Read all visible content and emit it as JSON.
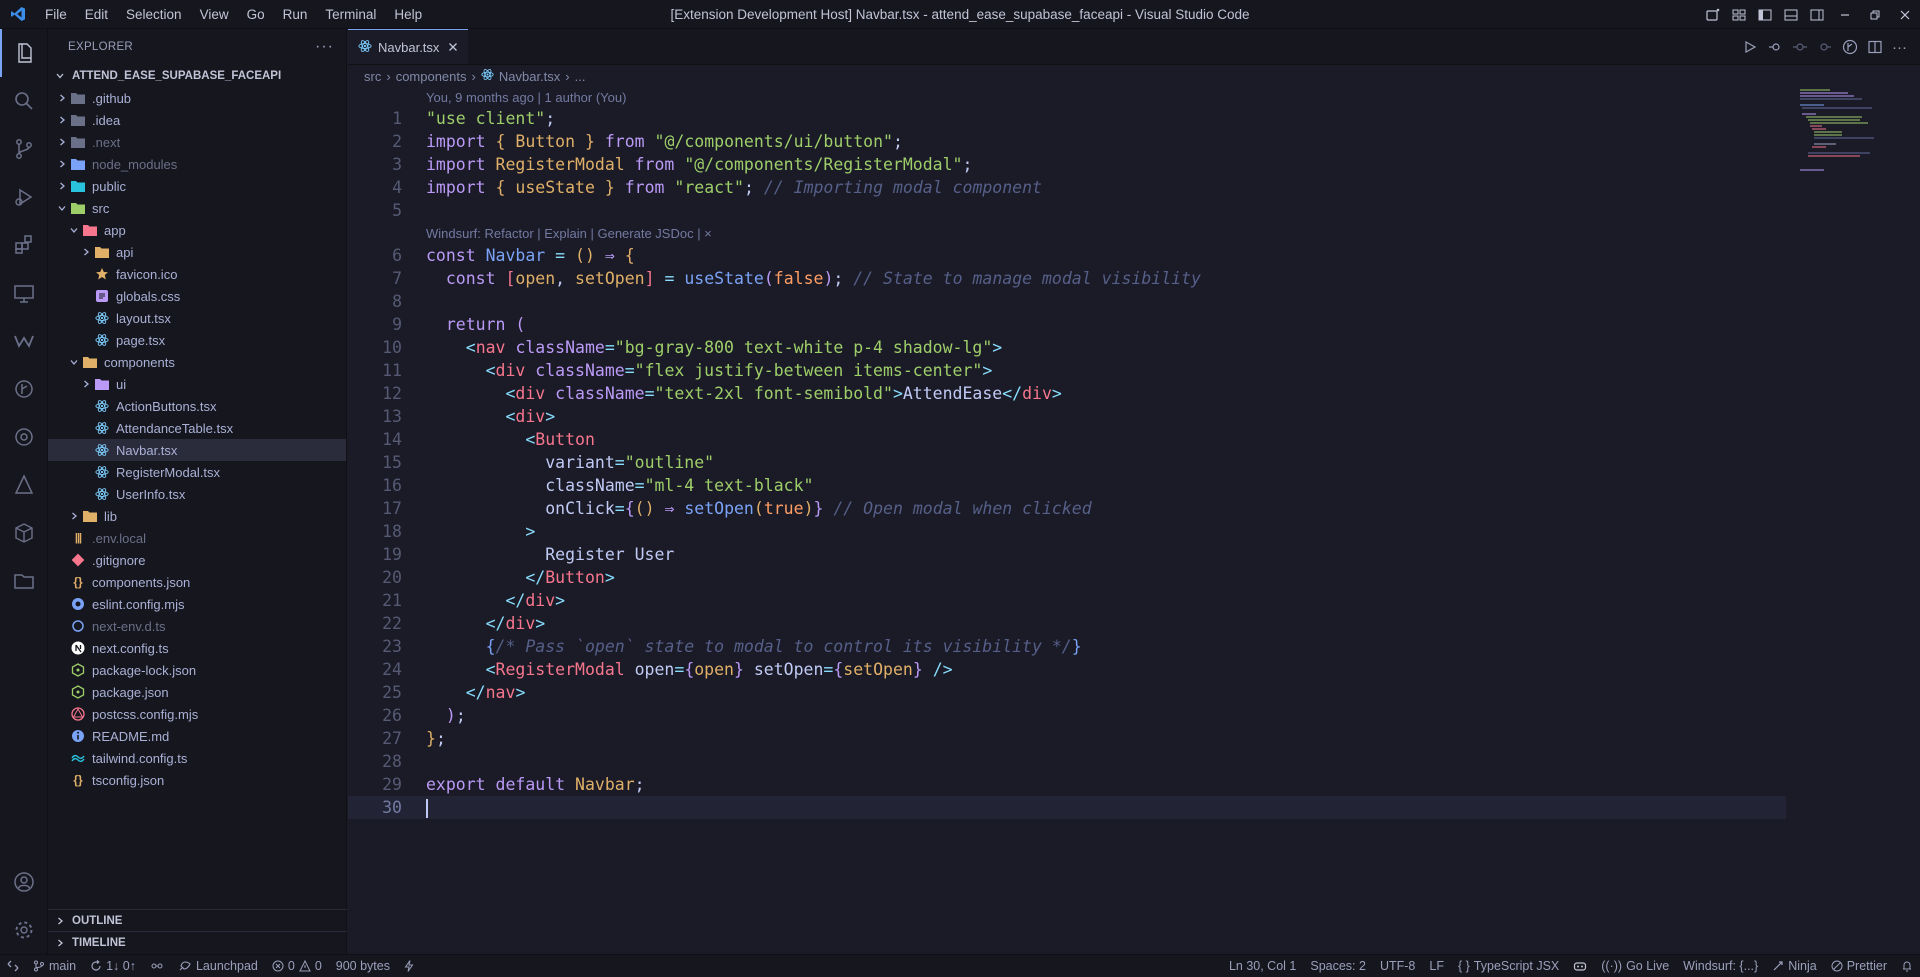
{
  "window": {
    "title": "[Extension Development Host] Navbar.tsx - attend_ease_supabase_faceapi - Visual Studio Code",
    "menu": [
      "File",
      "Edit",
      "Selection",
      "View",
      "Go",
      "Run",
      "Terminal",
      "Help"
    ]
  },
  "sidebar": {
    "header": "EXPLORER",
    "project": "ATTEND_EASE_SUPABASE_FACEAPI",
    "items": [
      {
        "label": ".github",
        "indent": 1,
        "type": "folder",
        "chevron": "right",
        "color": "#6b7089"
      },
      {
        "label": ".idea",
        "indent": 1,
        "type": "folder",
        "chevron": "right",
        "color": "#6b7089"
      },
      {
        "label": ".next",
        "indent": 1,
        "type": "folder",
        "chevron": "right",
        "color": "#6b7089",
        "dim": true
      },
      {
        "label": "node_modules",
        "indent": 1,
        "type": "folder",
        "chevron": "right",
        "color": "#7aa2f7",
        "dim": true
      },
      {
        "label": "public",
        "indent": 1,
        "type": "folder",
        "chevron": "right",
        "color": "#2ac3de"
      },
      {
        "label": "src",
        "indent": 1,
        "type": "folder",
        "chevron": "down",
        "color": "#9ece6a"
      },
      {
        "label": "app",
        "indent": 2,
        "type": "folder",
        "chevron": "down",
        "color": "#f7768e"
      },
      {
        "label": "api",
        "indent": 3,
        "type": "folder",
        "chevron": "right",
        "color": "#e0af68"
      },
      {
        "label": "favicon.ico",
        "indent": 3,
        "type": "star",
        "color": "#e0af68"
      },
      {
        "label": "globals.css",
        "indent": 3,
        "type": "css",
        "color": "#bb9af7"
      },
      {
        "label": "layout.tsx",
        "indent": 3,
        "type": "react",
        "color": "#7dcfff"
      },
      {
        "label": "page.tsx",
        "indent": 3,
        "type": "react",
        "color": "#7dcfff"
      },
      {
        "label": "components",
        "indent": 2,
        "type": "folder",
        "chevron": "down",
        "color": "#e0af68"
      },
      {
        "label": "ui",
        "indent": 3,
        "type": "folder",
        "chevron": "right",
        "color": "#bb9af7"
      },
      {
        "label": "ActionButtons.tsx",
        "indent": 3,
        "type": "react",
        "color": "#7dcfff"
      },
      {
        "label": "AttendanceTable.tsx",
        "indent": 3,
        "type": "react",
        "color": "#7dcfff"
      },
      {
        "label": "Navbar.tsx",
        "indent": 3,
        "type": "react",
        "color": "#7dcfff",
        "selected": true
      },
      {
        "label": "RegisterModal.tsx",
        "indent": 3,
        "type": "react",
        "color": "#7dcfff"
      },
      {
        "label": "UserInfo.tsx",
        "indent": 3,
        "type": "react",
        "color": "#7dcfff"
      },
      {
        "label": "lib",
        "indent": 2,
        "type": "folder",
        "chevron": "right",
        "color": "#e0af68"
      },
      {
        "label": ".env.local",
        "indent": 1,
        "type": "env",
        "color": "#e0af68",
        "dim": true
      },
      {
        "label": ".gitignore",
        "indent": 1,
        "type": "git",
        "color": "#f7768e"
      },
      {
        "label": "components.json",
        "indent": 1,
        "type": "json",
        "color": "#e0af68"
      },
      {
        "label": "eslint.config.mjs",
        "indent": 1,
        "type": "eslint",
        "color": "#7aa2f7"
      },
      {
        "label": "next-env.d.ts",
        "indent": 1,
        "type": "ts",
        "color": "#7aa2f7",
        "dim": true
      },
      {
        "label": "next.config.ts",
        "indent": 1,
        "type": "next",
        "color": "#ffffff"
      },
      {
        "label": "package-lock.json",
        "indent": 1,
        "type": "npm",
        "color": "#9ece6a"
      },
      {
        "label": "package.json",
        "indent": 1,
        "type": "npm",
        "color": "#9ece6a"
      },
      {
        "label": "postcss.config.mjs",
        "indent": 1,
        "type": "postcss",
        "color": "#f7768e"
      },
      {
        "label": "README.md",
        "indent": 1,
        "type": "info",
        "color": "#7aa2f7"
      },
      {
        "label": "tailwind.config.ts",
        "indent": 1,
        "type": "tailwind",
        "color": "#2ac3de"
      },
      {
        "label": "tsconfig.json",
        "indent": 1,
        "type": "json",
        "color": "#e0af68"
      }
    ],
    "outline": "OUTLINE",
    "timeline": "TIMELINE"
  },
  "editor": {
    "tab": "Navbar.tsx",
    "breadcrumb": [
      "src",
      "components",
      "Navbar.tsx",
      "..."
    ],
    "blame": "You, 9 months ago | 1 author (You)",
    "codelens": "Windsurf: Refactor | Explain | Generate JSDoc | ×",
    "lines": [
      {
        "n": "1",
        "html": "<span class='s'>\"use client\"</span><span class='p'>;</span>"
      },
      {
        "n": "2",
        "html": "<span class='k'>import</span> <span class='v'>{</span> <span class='v'>Button</span> <span class='v'>}</span> <span class='k'>from</span> <span class='s'>\"@/components/ui/button\"</span><span class='p'>;</span>"
      },
      {
        "n": "3",
        "html": "<span class='k'>import</span> <span class='v'>RegisterModal</span> <span class='k'>from</span> <span class='s'>\"@/components/RegisterModal\"</span><span class='p'>;</span>"
      },
      {
        "n": "4",
        "html": "<span class='k'>import</span> <span class='v'>{</span> <span class='v'>useState</span> <span class='v'>}</span> <span class='k'>from</span> <span class='s'>\"react\"</span><span class='p'>;</span> <span class='c'>// Importing modal component</span>"
      },
      {
        "n": "5",
        "html": ""
      },
      {
        "n": "6",
        "html": "<span class='k'>const</span> <span class='f'>Navbar</span> <span class='o'>=</span> <span class='v'>()</span> <span class='k'>⇒</span> <span class='v'>{</span>",
        "lens": true
      },
      {
        "n": "7",
        "html": "  <span class='k'>const</span> <span class='t'>[</span><span class='v'>open</span><span class='p'>,</span> <span class='v'>setOpen</span><span class='t'>]</span> <span class='o'>=</span> <span class='f'>useState</span><span class='k'>(</span><span class='b'>false</span><span class='k'>)</span><span class='p'>;</span> <span class='c'>// State to manage modal visibility</span>"
      },
      {
        "n": "8",
        "html": ""
      },
      {
        "n": "9",
        "html": "  <span class='k'>return</span> <span class='k'>(</span>"
      },
      {
        "n": "10",
        "html": "    <span class='o'>&lt;</span><span class='t'>nav</span> <span class='k'>className</span><span class='o'>=</span><span class='s'>\"bg-gray-800 text-white p-4 shadow-lg\"</span><span class='o'>&gt;</span>"
      },
      {
        "n": "11",
        "html": "      <span class='o'>&lt;</span><span class='t'>div</span> <span class='k'>className</span><span class='o'>=</span><span class='s'>\"flex justify-between items-center\"</span><span class='o'>&gt;</span>"
      },
      {
        "n": "12",
        "html": "        <span class='o'>&lt;</span><span class='t'>div</span> <span class='k'>className</span><span class='o'>=</span><span class='s'>\"text-2xl font-semibold\"</span><span class='o'>&gt;</span><span class='p'>AttendEase</span><span class='o'>&lt;/</span><span class='t'>div</span><span class='o'>&gt;</span>"
      },
      {
        "n": "13",
        "html": "        <span class='o'>&lt;</span><span class='t'>div</span><span class='o'>&gt;</span>"
      },
      {
        "n": "14",
        "html": "          <span class='o'>&lt;</span><span class='t'>Button</span>"
      },
      {
        "n": "15",
        "html": "            <span class='p'>variant</span><span class='o'>=</span><span class='s'>\"outline\"</span>"
      },
      {
        "n": "16",
        "html": "            <span class='p'>className</span><span class='o'>=</span><span class='s'>\"ml-4 text-black\"</span>"
      },
      {
        "n": "17",
        "html": "            <span class='p'>onClick</span><span class='o'>=</span><span class='k'>{</span><span class='v'>()</span> <span class='k'>⇒</span> <span class='f'>setOpen</span><span class='v'>(</span><span class='b'>true</span><span class='v'>)</span><span class='k'>}</span> <span class='c'>// Open modal when clicked</span>"
      },
      {
        "n": "18",
        "html": "          <span class='o'>&gt;</span>"
      },
      {
        "n": "19",
        "html": "            <span class='p'>Register User</span>"
      },
      {
        "n": "20",
        "html": "          <span class='o'>&lt;/</span><span class='t'>Button</span><span class='o'>&gt;</span>"
      },
      {
        "n": "21",
        "html": "        <span class='o'>&lt;/</span><span class='t'>div</span><span class='o'>&gt;</span>"
      },
      {
        "n": "22",
        "html": "      <span class='o'>&lt;/</span><span class='t'>div</span><span class='o'>&gt;</span>"
      },
      {
        "n": "23",
        "html": "      <span class='f'>{</span><span class='c'>/* Pass `open` state to modal to control its visibility */</span><span class='f'>}</span>"
      },
      {
        "n": "24",
        "html": "      <span class='o'>&lt;</span><span class='t'>RegisterModal</span> <span class='p'>open</span><span class='o'>=</span><span class='k'>{</span><span class='v'>open</span><span class='k'>}</span> <span class='p'>setOpen</span><span class='o'>=</span><span class='k'>{</span><span class='v'>setOpen</span><span class='k'>}</span> <span class='o'>/&gt;</span>"
      },
      {
        "n": "25",
        "html": "    <span class='o'>&lt;/</span><span class='t'>nav</span><span class='o'>&gt;</span>"
      },
      {
        "n": "26",
        "html": "  <span class='k'>)</span><span class='p'>;</span>"
      },
      {
        "n": "27",
        "html": "<span class='v'>}</span><span class='p'>;</span>"
      },
      {
        "n": "28",
        "html": ""
      },
      {
        "n": "29",
        "html": "<span class='k'>export</span> <span class='k'>default</span> <span class='v'>Navbar</span><span class='p'>;</span>"
      },
      {
        "n": "30",
        "html": "",
        "current": true
      }
    ]
  },
  "status": {
    "branch": "main",
    "sync": "1↓ 0↑",
    "launchpad": "Launchpad",
    "errors": "0",
    "warnings": "0",
    "size": "900 bytes",
    "position": "Ln 30, Col 1",
    "spaces": "Spaces: 2",
    "encoding": "UTF-8",
    "eol": "LF",
    "language": "TypeScript JSX",
    "golive": "Go Live",
    "windsurf": "Windsurf: {...}",
    "ninja": "Ninja",
    "prettier": "Prettier"
  }
}
